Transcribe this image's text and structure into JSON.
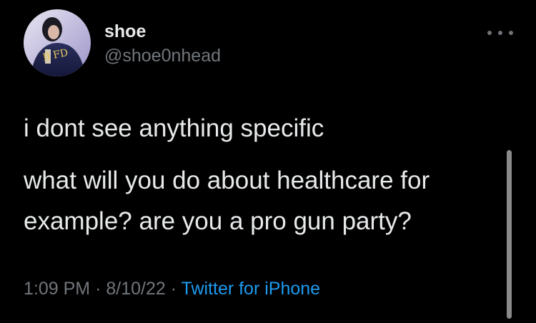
{
  "author": {
    "display_name": "shoe",
    "handle": "@shoe0nhead",
    "avatar_icon": "profile-avatar"
  },
  "menu": {
    "icon": "more-horizontal-icon"
  },
  "tweet": {
    "paragraph1": "i dont see anything specific",
    "paragraph2_line1": "what will you do about healthcare for",
    "paragraph2_line2": "example? are you a pro gun party?"
  },
  "meta": {
    "time": "1:09 PM",
    "separator1": "·",
    "date": "8/10/22",
    "separator2": "·",
    "source": "Twitter for iPhone"
  },
  "colors": {
    "background": "#000000",
    "primary_text": "#e7e9ea",
    "secondary_text": "#71767b",
    "link": "#1d9bf0"
  }
}
